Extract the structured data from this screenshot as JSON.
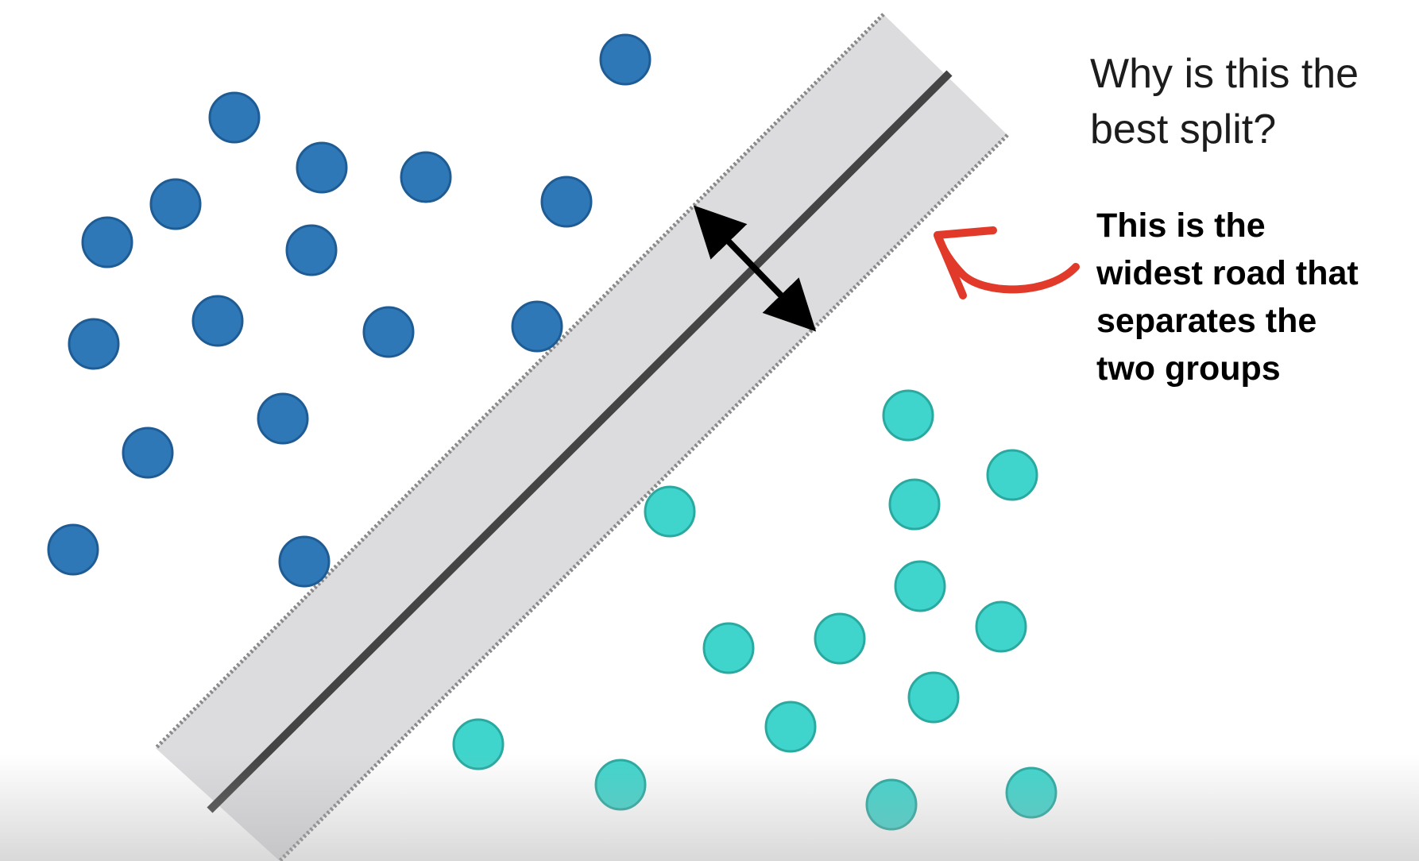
{
  "question": {
    "line1": "Why is this the",
    "line2": "best split?"
  },
  "answer": {
    "line1": "This is the",
    "line2": "widest road that",
    "line3": "separates the",
    "line4": "two groups"
  },
  "colors": {
    "group_a_fill": "#2f78b8",
    "group_a_stroke": "#1f5c94",
    "group_b_fill": "#40d5cc",
    "group_b_stroke": "#2aa9a0",
    "road_fill": "#dcdbde",
    "divider": "#444444",
    "margin_line": "#8a8a8a",
    "arrow": "#000000",
    "callout_arrow": "#e23a2a"
  },
  "icons": {
    "width_arrow": "double-headed-arrow",
    "callout": "curved-arrow"
  }
}
